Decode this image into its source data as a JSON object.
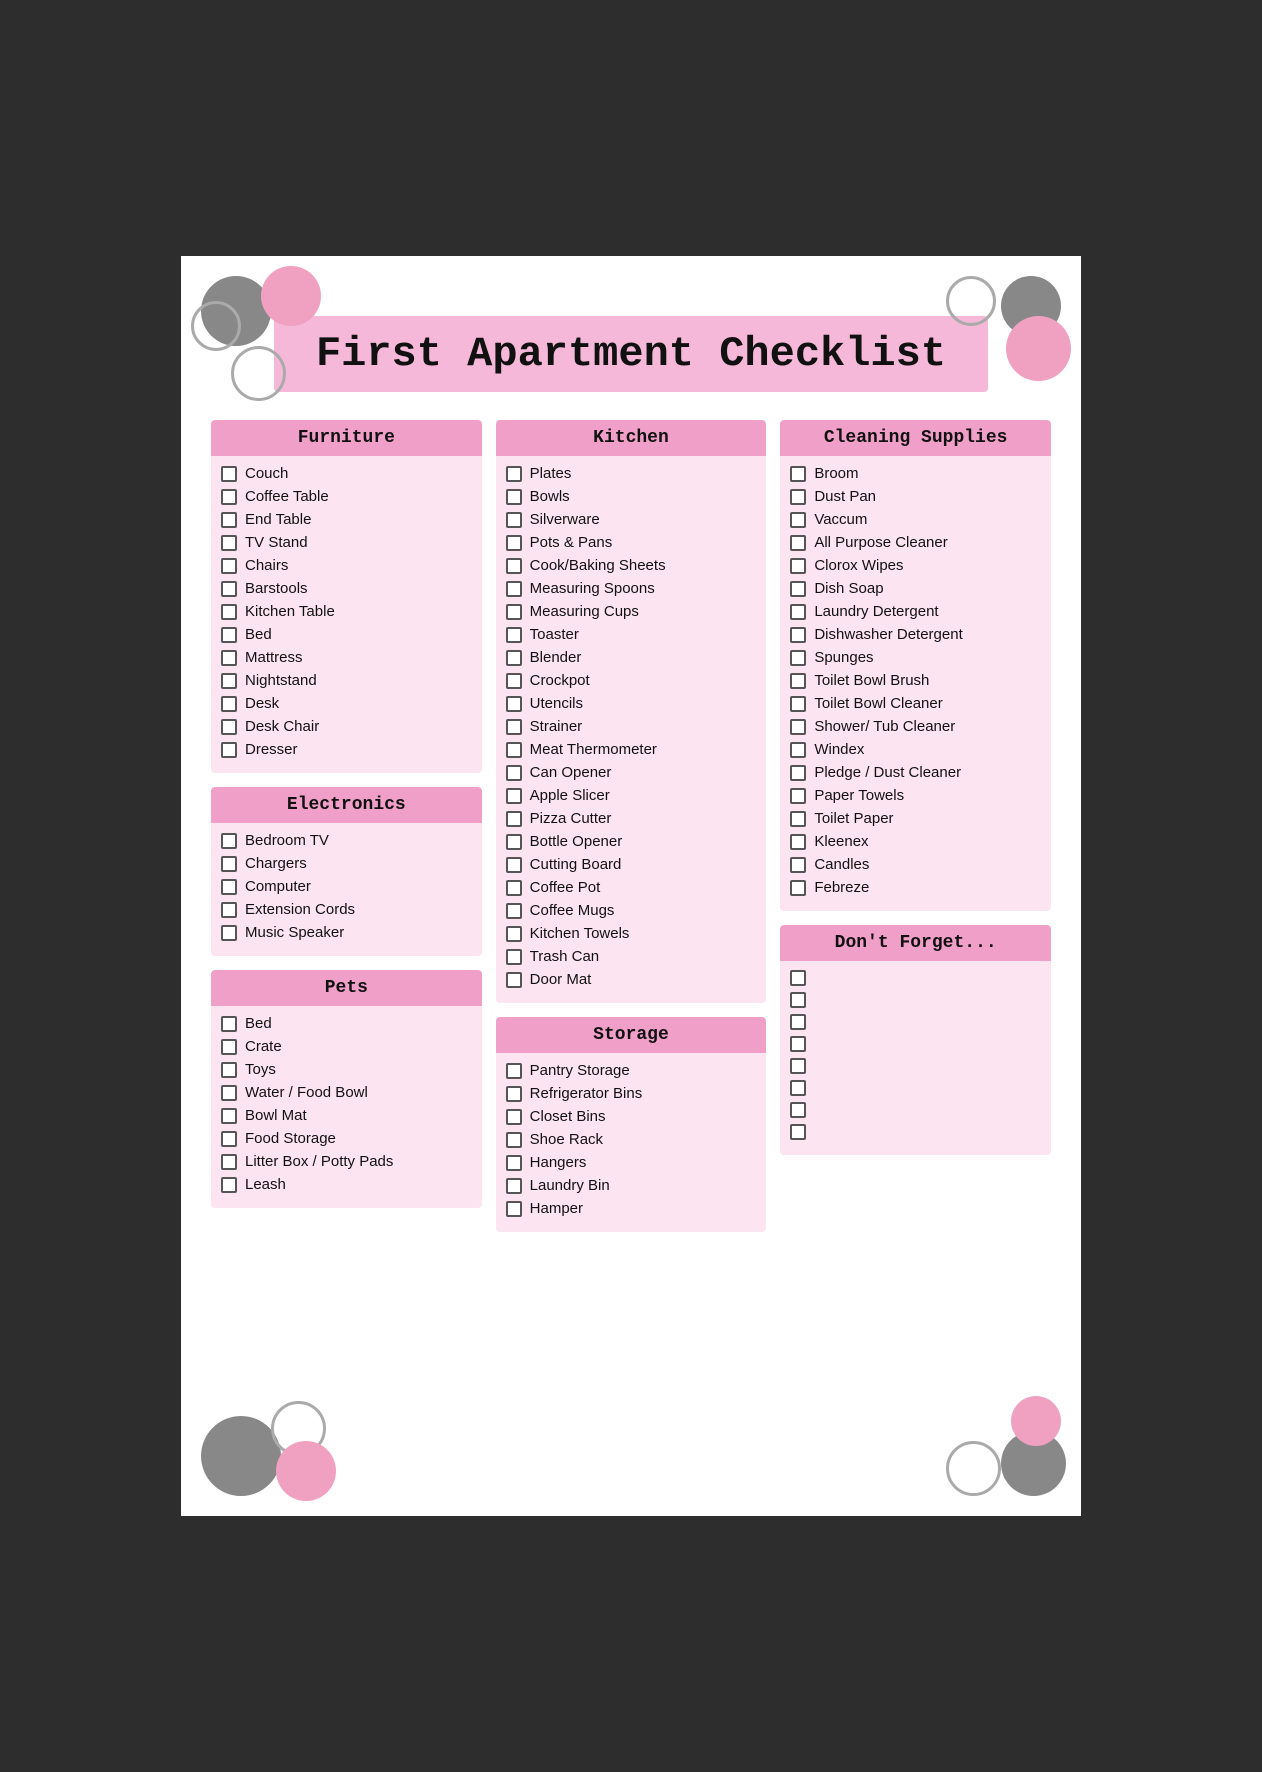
{
  "title": "First Apartment Checklist",
  "sections": {
    "furniture": {
      "header": "Furniture",
      "items": [
        "Couch",
        "Coffee Table",
        "End Table",
        "TV Stand",
        "Chairs",
        "Barstools",
        "Kitchen Table",
        "Bed",
        "Mattress",
        "Nightstand",
        "Desk",
        "Desk Chair",
        "Dresser"
      ]
    },
    "electronics": {
      "header": "Electronics",
      "items": [
        "Bedroom TV",
        "Chargers",
        "Computer",
        "Extension Cords",
        "Music Speaker"
      ]
    },
    "pets": {
      "header": "Pets",
      "items": [
        "Bed",
        "Crate",
        "Toys",
        "Water / Food Bowl",
        "Bowl Mat",
        "Food Storage",
        "Litter Box / Potty Pads",
        "Leash"
      ]
    },
    "kitchen": {
      "header": "Kitchen",
      "items": [
        "Plates",
        "Bowls",
        "Silverware",
        "Pots & Pans",
        "Cook/Baking Sheets",
        "Measuring Spoons",
        "Measuring Cups",
        "Toaster",
        "Blender",
        "Crockpot",
        "Utencils",
        "Strainer",
        "Meat Thermometer",
        "Can Opener",
        "Apple Slicer",
        "Pizza Cutter",
        "Bottle Opener",
        "Cutting Board",
        "Coffee Pot",
        "Coffee Mugs",
        "Kitchen Towels",
        "Trash Can",
        "Door Mat"
      ]
    },
    "storage": {
      "header": "Storage",
      "items": [
        "Pantry Storage",
        "Refrigerator Bins",
        "Closet Bins",
        "Shoe Rack",
        "Hangers",
        "Laundry Bin",
        "Hamper"
      ]
    },
    "cleaning": {
      "header": "Cleaning Supplies",
      "items": [
        "Broom",
        "Dust Pan",
        "Vaccum",
        "All Purpose Cleaner",
        "Clorox Wipes",
        "Dish Soap",
        "Laundry Detergent",
        "Dishwasher Detergent",
        "Spunges",
        "Toilet Bowl Brush",
        "Toilet Bowl Cleaner",
        "Shower/ Tub Cleaner",
        "Windex",
        "Pledge / Dust Cleaner",
        "Paper Towels",
        "Toilet Paper",
        "Kleenex",
        "Candles",
        "Febreze"
      ]
    },
    "dont_forget": {
      "header": "Don't Forget...",
      "items": [
        "",
        "",
        "",
        "",
        "",
        "",
        "",
        ""
      ]
    }
  }
}
